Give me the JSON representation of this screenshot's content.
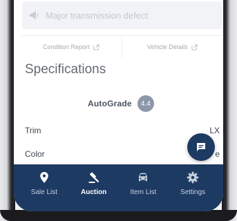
{
  "alert": {
    "text": "Major transmission defect"
  },
  "report_tabs": [
    {
      "label": "Condition Report"
    },
    {
      "label": "Vehicle Details"
    }
  ],
  "specifications": {
    "title": "Specifications",
    "autograde": {
      "logo": "AutoGrade",
      "score": "4.4"
    },
    "rows": [
      {
        "label": "Trim",
        "value": "LX"
      },
      {
        "label": "Color",
        "value": "e"
      }
    ]
  },
  "bottom_nav": {
    "items": [
      {
        "label": "Sale List",
        "icon": "map-pin-icon"
      },
      {
        "label": "Auction",
        "icon": "gavel-icon",
        "active": true
      },
      {
        "label": "Item List",
        "icon": "car-icon"
      },
      {
        "label": "Settings",
        "icon": "gear-icon"
      }
    ]
  },
  "colors": {
    "nav_bg": "#1d3a62",
    "badge_bg": "#8c97ab"
  }
}
